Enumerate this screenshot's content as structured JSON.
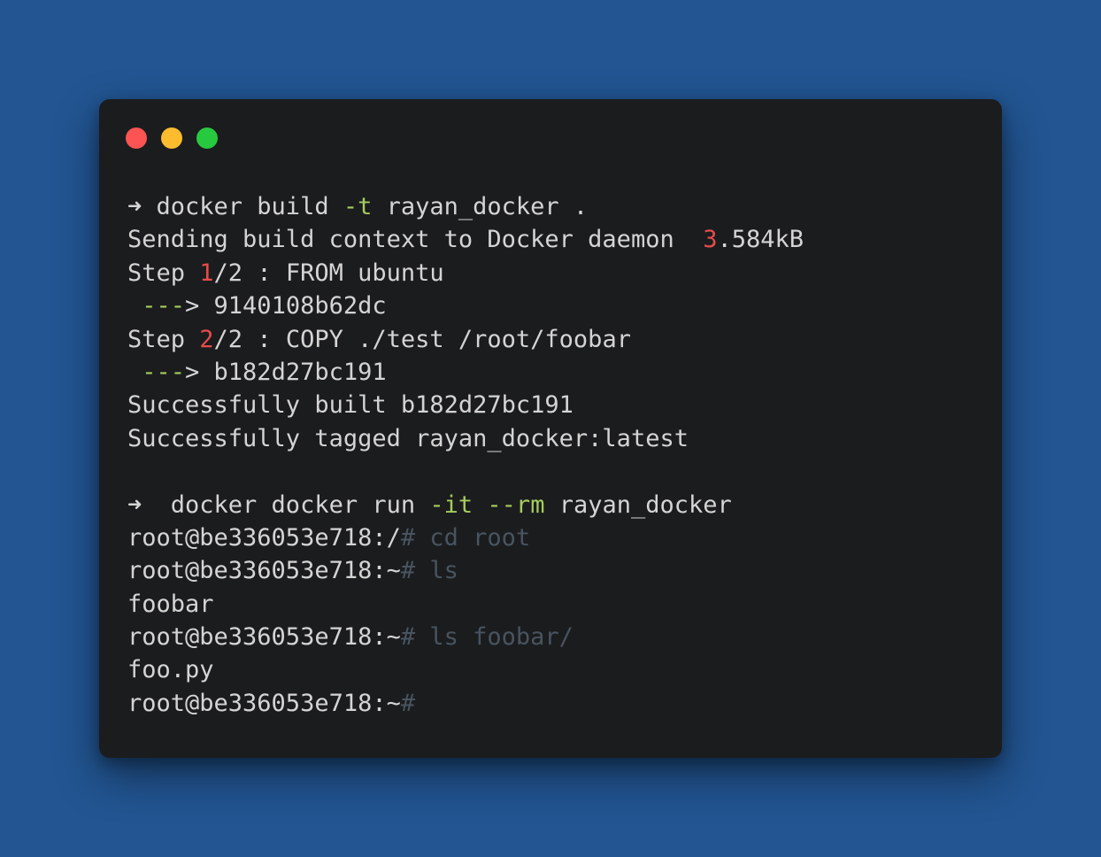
{
  "window": {
    "buttons": {
      "close_color": "#fb5453",
      "minimize_color": "#fdbc2e",
      "maximize_color": "#27c93f"
    }
  },
  "terminal": {
    "lines": [
      [
        {
          "text": "➜ docker build ",
          "style": "plain"
        },
        {
          "text": "-t",
          "style": "flag"
        },
        {
          "text": " rayan_docker .",
          "style": "plain"
        }
      ],
      [
        {
          "text": "Sending build context to Docker daemon  ",
          "style": "plain"
        },
        {
          "text": "3",
          "style": "num"
        },
        {
          "text": ".584kB",
          "style": "plain"
        }
      ],
      [
        {
          "text": "Step ",
          "style": "plain"
        },
        {
          "text": "1",
          "style": "num"
        },
        {
          "text": "/2 : FROM ubuntu",
          "style": "plain"
        }
      ],
      [
        {
          "text": " ---",
          "style": "arrow"
        },
        {
          "text": "> 9140108b62dc",
          "style": "plain"
        }
      ],
      [
        {
          "text": "Step ",
          "style": "plain"
        },
        {
          "text": "2",
          "style": "num"
        },
        {
          "text": "/2 : COPY ./test /root/foobar",
          "style": "plain"
        }
      ],
      [
        {
          "text": " ---",
          "style": "arrow"
        },
        {
          "text": "> b182d27bc191",
          "style": "plain"
        }
      ],
      [
        {
          "text": "Successfully built b182d27bc191",
          "style": "plain"
        }
      ],
      [
        {
          "text": "Successfully tagged rayan_docker:latest",
          "style": "plain"
        }
      ],
      [],
      [
        {
          "text": "➜  docker docker run ",
          "style": "plain"
        },
        {
          "text": "-it",
          "style": "flag"
        },
        {
          "text": " ",
          "style": "plain"
        },
        {
          "text": "--rm",
          "style": "flag"
        },
        {
          "text": " rayan_docker",
          "style": "plain"
        }
      ],
      [
        {
          "text": "root@be336053e718:/",
          "style": "plain"
        },
        {
          "text": "# cd root",
          "style": "cmd"
        }
      ],
      [
        {
          "text": "root@be336053e718:~",
          "style": "plain"
        },
        {
          "text": "# ls",
          "style": "cmd"
        }
      ],
      [
        {
          "text": "foobar",
          "style": "plain"
        }
      ],
      [
        {
          "text": "root@be336053e718:~",
          "style": "plain"
        },
        {
          "text": "# ls foobar/",
          "style": "cmd"
        }
      ],
      [
        {
          "text": "foo.py",
          "style": "plain"
        }
      ],
      [
        {
          "text": "root@be336053e718:~",
          "style": "plain"
        },
        {
          "text": "#",
          "style": "cmd"
        }
      ]
    ]
  },
  "colors": {
    "background": "#225592",
    "window": "#1b1c1e",
    "text": "#d4d4d4",
    "flag": "#a6cc5c",
    "number": "#e64b4b",
    "command": "#48545f"
  }
}
